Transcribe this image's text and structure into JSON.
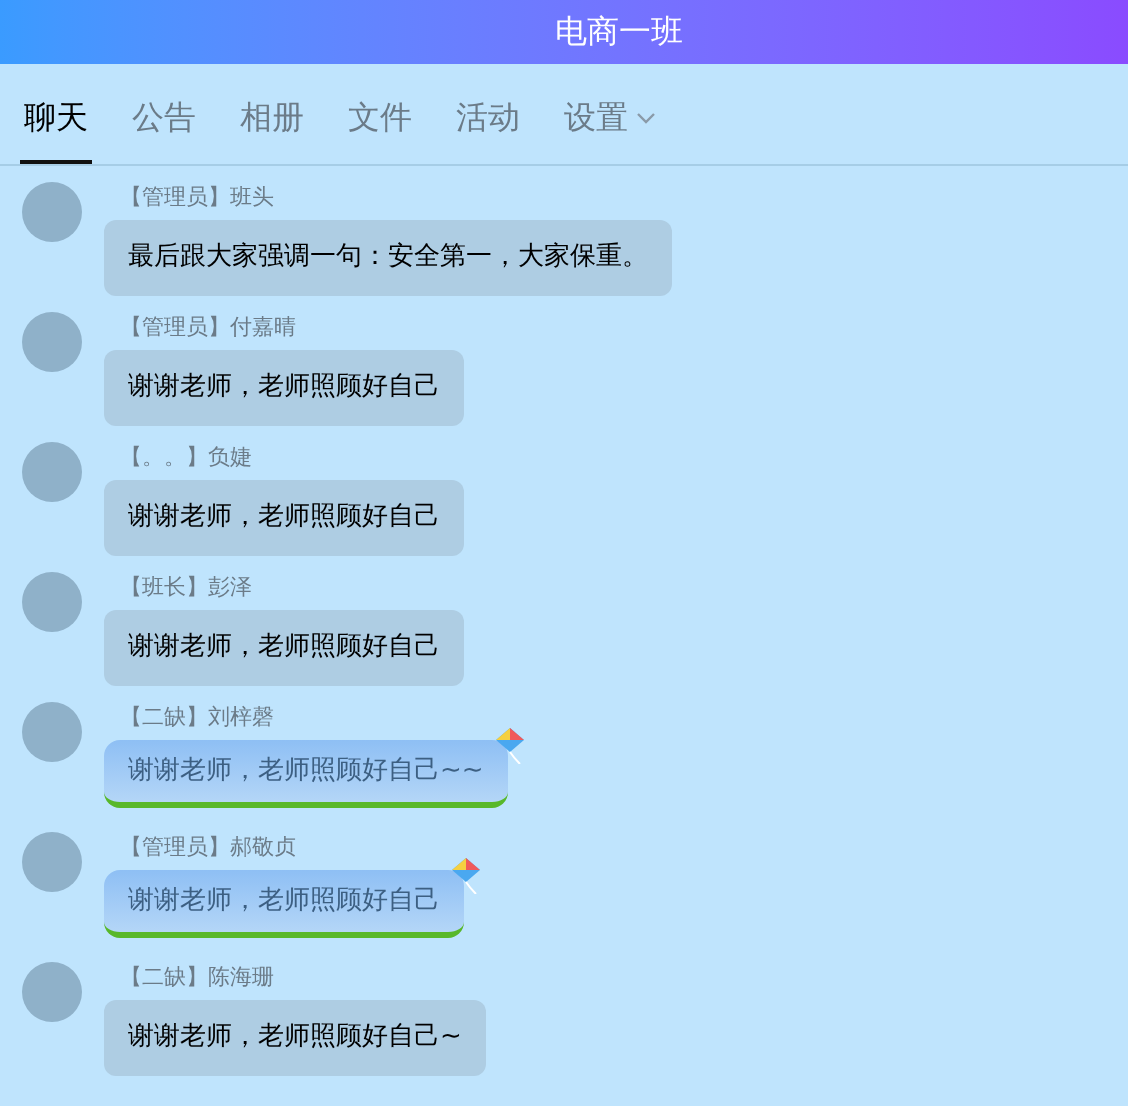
{
  "header": {
    "title": "电商一班"
  },
  "tabs": [
    {
      "label": "聊天",
      "selected": true,
      "kind": "plain"
    },
    {
      "label": "公告",
      "selected": false,
      "kind": "plain"
    },
    {
      "label": "相册",
      "selected": false,
      "kind": "plain"
    },
    {
      "label": "文件",
      "selected": false,
      "kind": "plain"
    },
    {
      "label": "活动",
      "selected": false,
      "kind": "plain"
    },
    {
      "label": "设置",
      "selected": false,
      "kind": "dropdown"
    }
  ],
  "messages": [
    {
      "role": "【管理员】",
      "name": "班头",
      "text": "最后跟大家强调一句：安全第一，大家保重。",
      "kind": "plain"
    },
    {
      "role": "【管理员】",
      "name": "付嘉晴",
      "text": "谢谢老师，老师照顾好自己",
      "kind": "plain"
    },
    {
      "role": "【。。】",
      "name": "负婕",
      "text": "谢谢老师，老师照顾好自己",
      "kind": "plain"
    },
    {
      "role": "【班长】",
      "name": "彭泽",
      "text": "谢谢老师，老师照顾好自己",
      "kind": "plain"
    },
    {
      "role": "【二缺】",
      "name": "刘梓磬",
      "text": "谢谢老师，老师照顾好自己~~",
      "kind": "kite"
    },
    {
      "role": "【管理员】",
      "name": "郝敬贞",
      "text": "谢谢老师，老师照顾好自己",
      "kind": "kite"
    },
    {
      "role": "【二缺】",
      "name": "陈海珊",
      "text": "谢谢老师，老师照顾好自己~",
      "kind": "plain"
    }
  ]
}
